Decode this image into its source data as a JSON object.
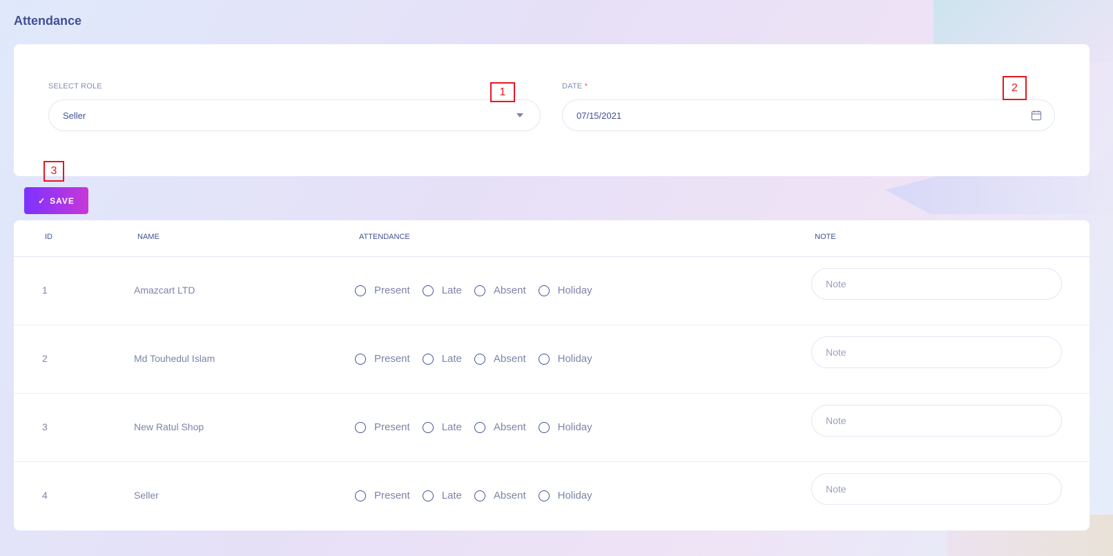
{
  "page": {
    "title": "Attendance"
  },
  "filters": {
    "role_label": "SELECT ROLE",
    "role_value": "Seller",
    "date_label": "DATE",
    "date_required": "*",
    "date_value": "07/15/2021"
  },
  "markers": [
    "1",
    "2",
    "3"
  ],
  "save_button": {
    "check": "✓",
    "label": "SAVE"
  },
  "table": {
    "headers": [
      "ID",
      "NAME",
      "ATTENDANCE",
      "NOTE"
    ],
    "options": [
      "Present",
      "Late",
      "Absent",
      "Holiday"
    ],
    "note_placeholder": "Note",
    "rows": [
      {
        "id": "1",
        "name": "Amazcart LTD"
      },
      {
        "id": "2",
        "name": "Md Touhedul Islam"
      },
      {
        "id": "3",
        "name": "New Ratul Shop"
      },
      {
        "id": "4",
        "name": "Seller"
      }
    ]
  },
  "colors": {
    "accent_start": "#7c32ff",
    "accent_end": "#c738d8",
    "text": "#415094",
    "marker": "#e8141f"
  },
  "icons": {
    "dropdown": "caret-down-icon",
    "date": "calendar-icon",
    "save": "check-icon"
  }
}
